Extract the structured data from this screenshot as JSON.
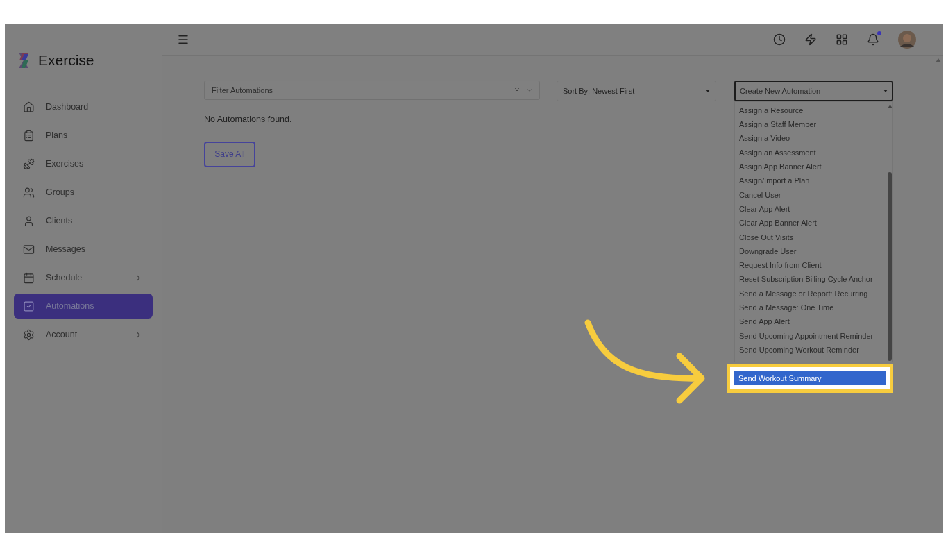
{
  "brand": {
    "name": "Exercise"
  },
  "sidebar": {
    "items": [
      {
        "label": "Dashboard",
        "selected": false,
        "expandable": false
      },
      {
        "label": "Plans",
        "selected": false,
        "expandable": false
      },
      {
        "label": "Exercises",
        "selected": false,
        "expandable": false
      },
      {
        "label": "Groups",
        "selected": false,
        "expandable": false
      },
      {
        "label": "Clients",
        "selected": false,
        "expandable": false
      },
      {
        "label": "Messages",
        "selected": false,
        "expandable": false
      },
      {
        "label": "Schedule",
        "selected": false,
        "expandable": true
      },
      {
        "label": "Automations",
        "selected": true,
        "expandable": false
      },
      {
        "label": "Account",
        "selected": false,
        "expandable": true
      }
    ]
  },
  "header": {
    "unread_notifications": true
  },
  "filter": {
    "placeholder": "Filter Automations"
  },
  "sort": {
    "value": "Sort By: Newest First"
  },
  "empty_message": "No Automations found.",
  "save_button": "Save All",
  "create_dropdown": {
    "value": "Create New Automation",
    "options": [
      {
        "label": "Assign a Resource",
        "selected": false
      },
      {
        "label": "Assign a Staff Member",
        "selected": false
      },
      {
        "label": "Assign a Video",
        "selected": false
      },
      {
        "label": "Assign an Assessment",
        "selected": false
      },
      {
        "label": "Assign App Banner Alert",
        "selected": false
      },
      {
        "label": "Assign/Import a Plan",
        "selected": false
      },
      {
        "label": "Cancel User",
        "selected": false
      },
      {
        "label": "Clear App Alert",
        "selected": false
      },
      {
        "label": "Clear App Banner Alert",
        "selected": false
      },
      {
        "label": "Close Out Visits",
        "selected": false
      },
      {
        "label": "Downgrade User",
        "selected": false
      },
      {
        "label": "Request Info from Client",
        "selected": false
      },
      {
        "label": "Reset Subscription Billing Cycle Anchor",
        "selected": false
      },
      {
        "label": "Send a Message or Report: Recurring",
        "selected": false
      },
      {
        "label": "Send a Message: One Time",
        "selected": false
      },
      {
        "label": "Send App Alert",
        "selected": false
      },
      {
        "label": "Send Upcoming Appointment Reminder",
        "selected": false
      },
      {
        "label": "Send Upcoming Workout Reminder",
        "selected": false
      },
      {
        "label": "Send Workout Summary",
        "selected": true
      }
    ]
  }
}
